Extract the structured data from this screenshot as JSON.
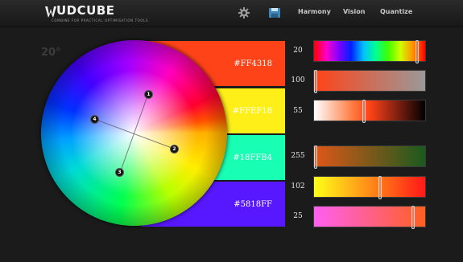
{
  "app": {
    "logo_text": "UDCUBE",
    "logo_tagline": "COMBINE FOR PRACTICAL OPTIMISATION TOOLS"
  },
  "nav": {
    "icons": [
      "gear-icon",
      "save-icon"
    ],
    "links": [
      "Harmony",
      "Vision",
      "Quantize"
    ]
  },
  "wheel": {
    "angle_label": "20°",
    "markers": [
      "1",
      "2",
      "3",
      "4"
    ]
  },
  "swatches": [
    {
      "hex": "#FF4318",
      "color": "#FF4318"
    },
    {
      "hex": "#FFEF18",
      "color": "#FFEF18"
    },
    {
      "hex": "#18FFB4",
      "color": "#18FFB4"
    },
    {
      "hex": "#5818FF",
      "color": "#5818FF"
    }
  ],
  "sliders": [
    {
      "value": "20",
      "level": 0.94
    },
    {
      "value": "100",
      "level": 0.0
    },
    {
      "value": "55",
      "level": 0.45
    },
    {
      "value": "255",
      "level": 0.0
    },
    {
      "value": "102",
      "level": 0.6
    },
    {
      "value": "25",
      "level": 0.9
    }
  ]
}
